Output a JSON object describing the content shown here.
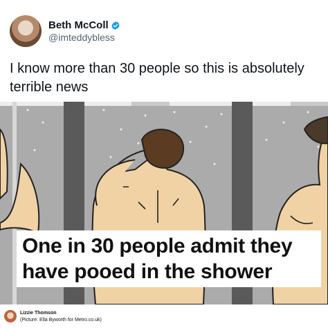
{
  "tweet": {
    "author_name": "Beth McColl",
    "handle": "@imteddybless",
    "text": "I know more than 30 people so this is absolutely terrible news",
    "verified": true
  },
  "image": {
    "caption_line_1": "One in 30 people admit they",
    "caption_line_2": "have pooed in the shower"
  },
  "footer": {
    "author": "Lizzie Thomson",
    "credit": "(Picture: Ella Byworth for Metro.co.uk)"
  },
  "colors": {
    "verified_badge": "#1d9bf0",
    "tile_background": "#aaa9a9",
    "shower_divider": "#555555",
    "skin": "#f0d2a5"
  },
  "icons": [
    "verified-badge-icon"
  ]
}
